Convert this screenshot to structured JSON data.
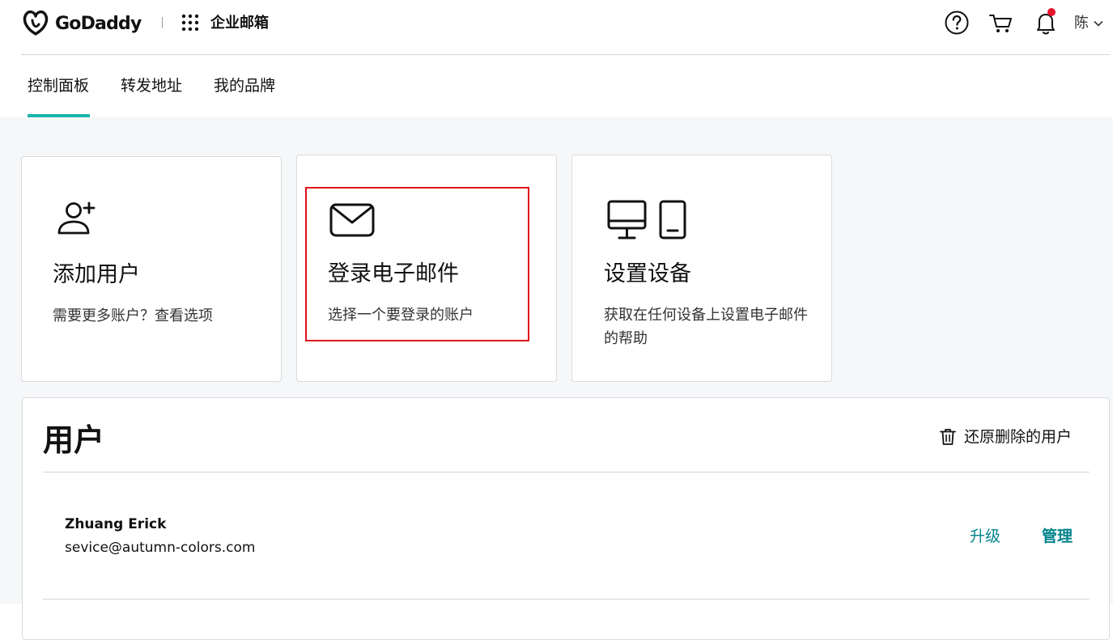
{
  "header": {
    "logo_text": "GoDaddy",
    "product_name": "企业邮箱",
    "user_initial": "陈",
    "icons": [
      "godaddy-logo-icon",
      "apps-grid-icon",
      "help-icon",
      "cart-icon",
      "bell-icon",
      "chevron-down-icon"
    ],
    "notification_dot_color": "#e4142a"
  },
  "tabs": [
    {
      "label": "控制面板",
      "active": true
    },
    {
      "label": "转发地址",
      "active": false
    },
    {
      "label": "我的品牌",
      "active": false
    }
  ],
  "accent_color": "#1bb5ad",
  "cards": [
    {
      "icon": "add-user-icon",
      "title": "添加用户",
      "description": "需要更多账户？查看选项"
    },
    {
      "icon": "envelope-icon",
      "title": "登录电子邮件",
      "description": "选择一个要登录的账户",
      "highlighted": true
    },
    {
      "icon": "devices-icon",
      "title": "设置设备",
      "description": "获取在任何设备上设置电子邮件的帮助"
    }
  ],
  "highlight_color": "#e0101a",
  "users": {
    "title": "用户",
    "restore_label": "还原删除的用户",
    "rows": [
      {
        "name": "Zhuang Erick",
        "email": "sevice@autumn-colors.com",
        "upgrade_label": "升级",
        "manage_label": "管理"
      }
    ]
  },
  "link_color": "#00838c"
}
